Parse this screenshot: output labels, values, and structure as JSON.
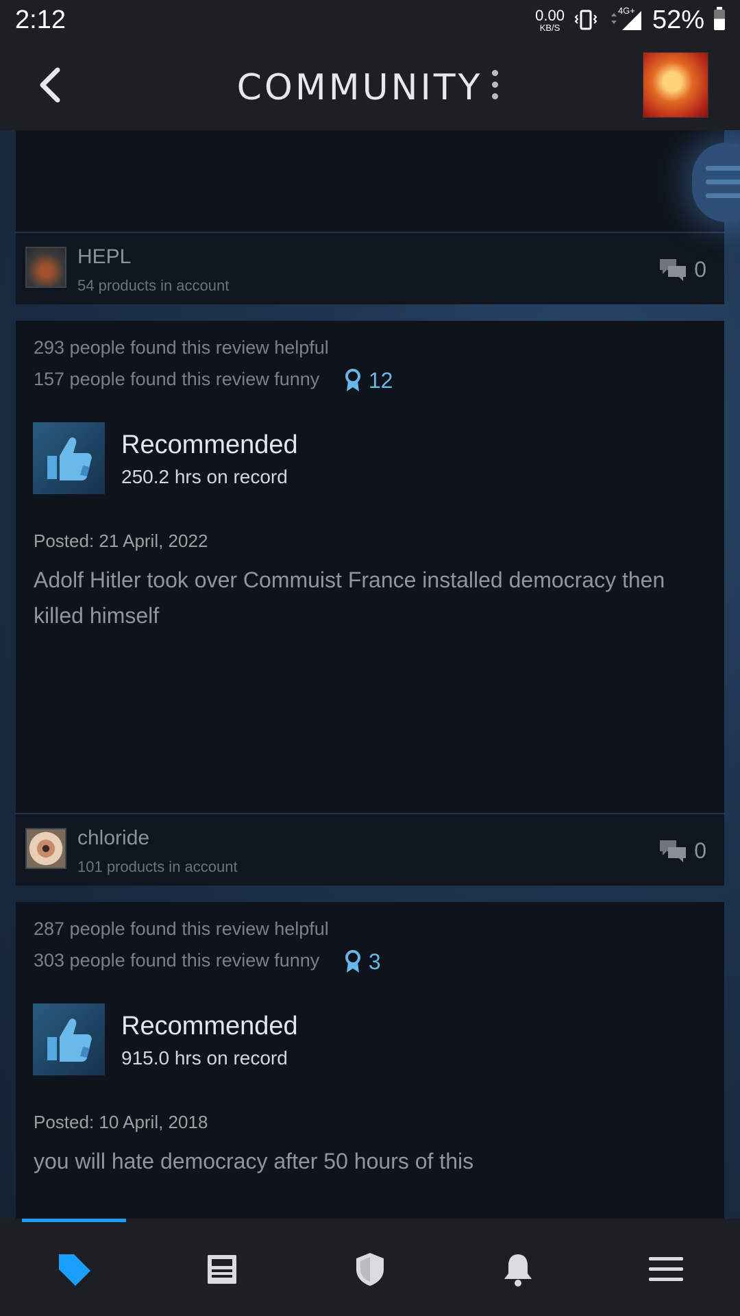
{
  "status_bar": {
    "time": "2:12",
    "net_speed_value": "0.00",
    "net_speed_unit": "KB/S",
    "network_type": "4G+",
    "battery": "52%"
  },
  "header": {
    "title": "COMMUNITY"
  },
  "reviews": [
    {
      "author": "HEPL",
      "products": "54 products in account",
      "comments": "0"
    },
    {
      "helpful": "293 people found this review helpful",
      "funny": "157 people found this review funny",
      "awards": "12",
      "recommendation": "Recommended",
      "hours": "250.2 hrs on record",
      "posted": "Posted: 21 April, 2022",
      "text": "Adolf Hitler took over Commuist France installed democracy then killed himself",
      "author": "chloride",
      "products": "101 products in account",
      "comments": "0"
    },
    {
      "helpful": "287 people found this review helpful",
      "funny": "303 people found this review funny",
      "awards": "3",
      "recommendation": "Recommended",
      "hours": "915.0 hrs on record",
      "posted": "Posted: 10 April, 2018",
      "text": "you will hate democracy after 50 hours of this"
    }
  ],
  "bottom_nav": {
    "items": [
      {
        "icon": "store-tag-icon",
        "active": true
      },
      {
        "icon": "news-icon",
        "active": false
      },
      {
        "icon": "shield-icon",
        "active": false
      },
      {
        "icon": "bell-icon",
        "active": false
      },
      {
        "icon": "menu-icon",
        "active": false
      }
    ],
    "active_color": "#1a9fff",
    "inactive_color": "#d9dcdf"
  }
}
